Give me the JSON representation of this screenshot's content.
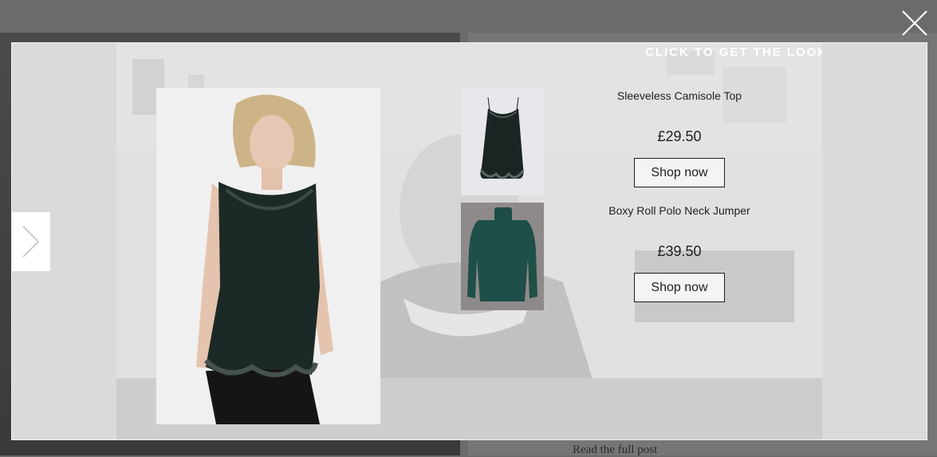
{
  "background": {
    "read_more_label": "Read the full post"
  },
  "lightbox": {
    "cta_label": "CLICK TO GET THE LOOK",
    "products": [
      {
        "name": "Sleeveless Camisole Top",
        "price": "£29.50",
        "button_label": "Shop now",
        "icon": "camisole-image"
      },
      {
        "name": "Boxy Roll Polo Neck Jumper",
        "price": "£39.50",
        "button_label": "Shop now",
        "icon": "jumper-image"
      }
    ]
  },
  "icons": {
    "close": "close-icon",
    "next": "chevron-right-icon"
  },
  "colors": {
    "overlay": "#6b6b6b",
    "panel": "#dadada",
    "button_border": "#1f1f1f",
    "garment_green": "#1e4f48"
  }
}
